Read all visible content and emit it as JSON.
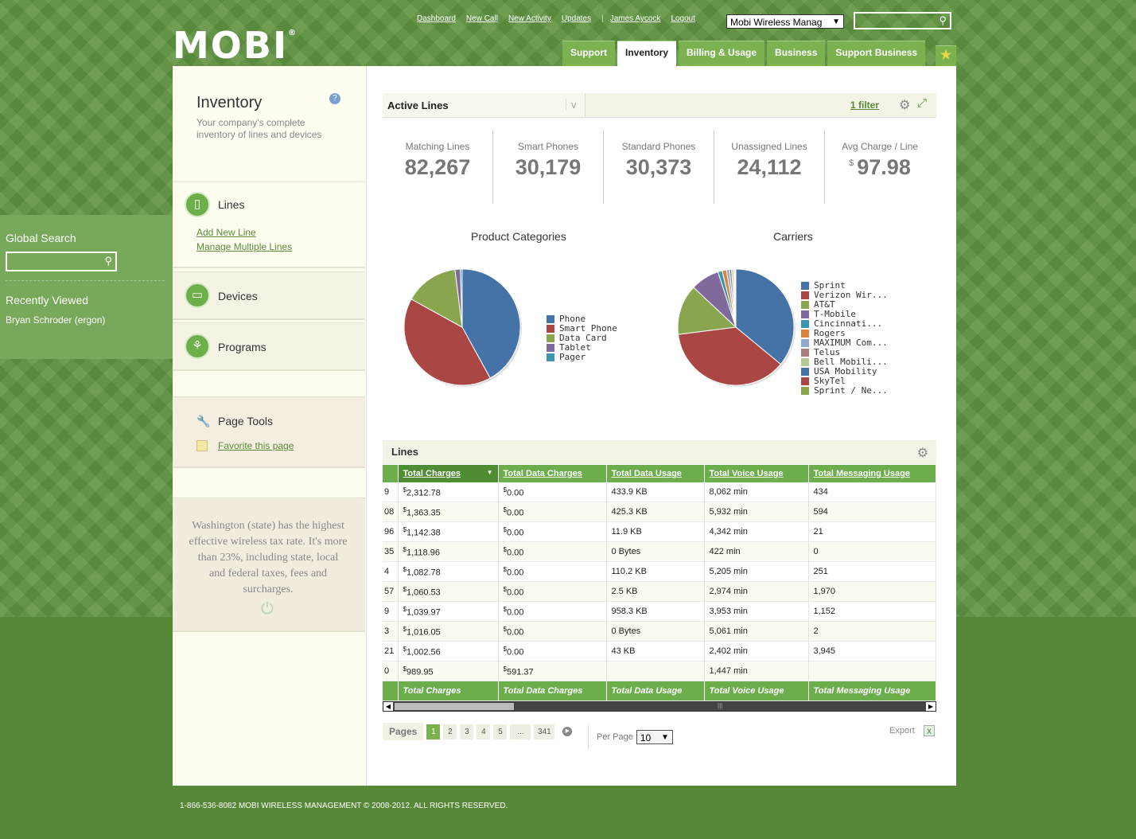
{
  "header": {
    "logo_text": "MOBI",
    "logo_mark": "®",
    "links": [
      "Dashboard",
      "New Call",
      "New Activity",
      "Updates"
    ],
    "separator": "|",
    "user": "James Aycock",
    "logout": "Logout",
    "company": "Mobi Wireless Manag",
    "tabs": [
      "Support",
      "Inventory",
      "Billing & Usage",
      "Business",
      "Support Business"
    ],
    "active_tab": "Inventory"
  },
  "global": {
    "search_title": "Global Search",
    "recently_viewed_title": "Recently Viewed",
    "recent_items": [
      "Bryan Schroder (ergon)"
    ]
  },
  "sidebar": {
    "title": "Inventory",
    "description": "Your company's complete inventory of lines and devices",
    "sections": {
      "lines": {
        "label": "Lines",
        "links": [
          "Add New Line",
          "Manage Multiple Lines"
        ]
      },
      "devices": {
        "label": "Devices"
      },
      "programs": {
        "label": "Programs"
      }
    },
    "page_tools": {
      "label": "Page Tools",
      "favorite": "Favorite this page"
    },
    "fact": "Washington (state) has the highest effective wireless tax rate. It's more than 23%, including state, local and federal taxes, fees and surcharges."
  },
  "main": {
    "view": "Active Lines",
    "filter": "1 filter",
    "stats": [
      {
        "label": "Matching Lines",
        "value": "82,267"
      },
      {
        "label": "Smart Phones",
        "value": "30,179"
      },
      {
        "label": "Standard Phones",
        "value": "30,373"
      },
      {
        "label": "Unassigned Lines",
        "value": "24,112"
      },
      {
        "label": "Avg Charge / Line",
        "currency": "$",
        "value": "97.98"
      }
    ],
    "lines_title": "Lines",
    "columns": [
      "Total Charges",
      "Total Data Charges",
      "Total Data Usage",
      "Total Voice Usage",
      "Total Messaging Usage"
    ],
    "rows": [
      {
        "cut": "9",
        "charges": "2,312.78",
        "data_charges": "0.00",
        "data_usage": "433.9 KB",
        "voice": "8,062 min",
        "msg": "434"
      },
      {
        "cut": "08",
        "charges": "1,363.35",
        "data_charges": "0.00",
        "data_usage": "425.3 KB",
        "voice": "5,932 min",
        "msg": "594"
      },
      {
        "cut": "96",
        "charges": "1,142.38",
        "data_charges": "0.00",
        "data_usage": "11.9 KB",
        "voice": "4,342 min",
        "msg": "21"
      },
      {
        "cut": "35",
        "charges": "1,118.96",
        "data_charges": "0.00",
        "data_usage": "0 Bytes",
        "voice": "422 min",
        "msg": "0"
      },
      {
        "cut": "4",
        "charges": "1,082.78",
        "data_charges": "0.00",
        "data_usage": "110.2 KB",
        "voice": "5,205 min",
        "msg": "251"
      },
      {
        "cut": "57",
        "charges": "1,060.53",
        "data_charges": "0.00",
        "data_usage": "2.5 KB",
        "voice": "2,974 min",
        "msg": "1,970"
      },
      {
        "cut": "9",
        "charges": "1,039.97",
        "data_charges": "0.00",
        "data_usage": "958.3 KB",
        "voice": "3,953 min",
        "msg": "1,152"
      },
      {
        "cut": "3",
        "charges": "1,016.05",
        "data_charges": "0.00",
        "data_usage": "0 Bytes",
        "voice": "5,061 min",
        "msg": "2"
      },
      {
        "cut": "21",
        "charges": "1,002.56",
        "data_charges": "0.00",
        "data_usage": "43 KB",
        "voice": "2,402 min",
        "msg": "3,945"
      },
      {
        "cut": "0",
        "charges": "989.95",
        "data_charges": "591.37",
        "data_usage": "",
        "voice": "1,447 min",
        "msg": ""
      }
    ],
    "currency": "$",
    "pager": {
      "label": "Pages",
      "pages": [
        "1",
        "2",
        "3",
        "4",
        "5",
        "...",
        "341"
      ],
      "current": "1",
      "per_page_label": "Per Page",
      "per_page": "10",
      "export": "Export"
    }
  },
  "chart_data": [
    {
      "type": "pie",
      "title": "Product Categories",
      "categories": [
        "Phone",
        "Smart Phone",
        "Data Card",
        "Tablet",
        "Pager"
      ],
      "values": [
        42,
        41,
        15,
        1.5,
        0.5
      ],
      "colors": [
        "#4572a7",
        "#aa4643",
        "#89a54e",
        "#80699b",
        "#3d96ae"
      ],
      "legend": "right"
    },
    {
      "type": "pie",
      "title": "Carriers",
      "categories": [
        "Sprint",
        "Verizon Wir...",
        "AT&T",
        "T-Mobile",
        "Cincinnati...",
        "Rogers",
        "MAXIMUM Com...",
        "Telus",
        "Bell Mobili...",
        "USA Mobility",
        "SkyTel",
        "Sprint / Ne..."
      ],
      "values": [
        36,
        37,
        14,
        8,
        1.2,
        1.2,
        0.8,
        0.6,
        0.5,
        0.3,
        0.2,
        0.2
      ],
      "colors": [
        "#4572a7",
        "#aa4643",
        "#89a54e",
        "#80699b",
        "#3d96ae",
        "#db843d",
        "#92a8cd",
        "#a47d7c",
        "#b5ca92",
        "#4572a7",
        "#aa4643",
        "#89a54e"
      ],
      "legend": "right"
    }
  ],
  "footer": "1-866-536-8082 MOBI WIRELESS MANAGEMENT © 2008-2012. ALL RIGHTS RESERVED."
}
